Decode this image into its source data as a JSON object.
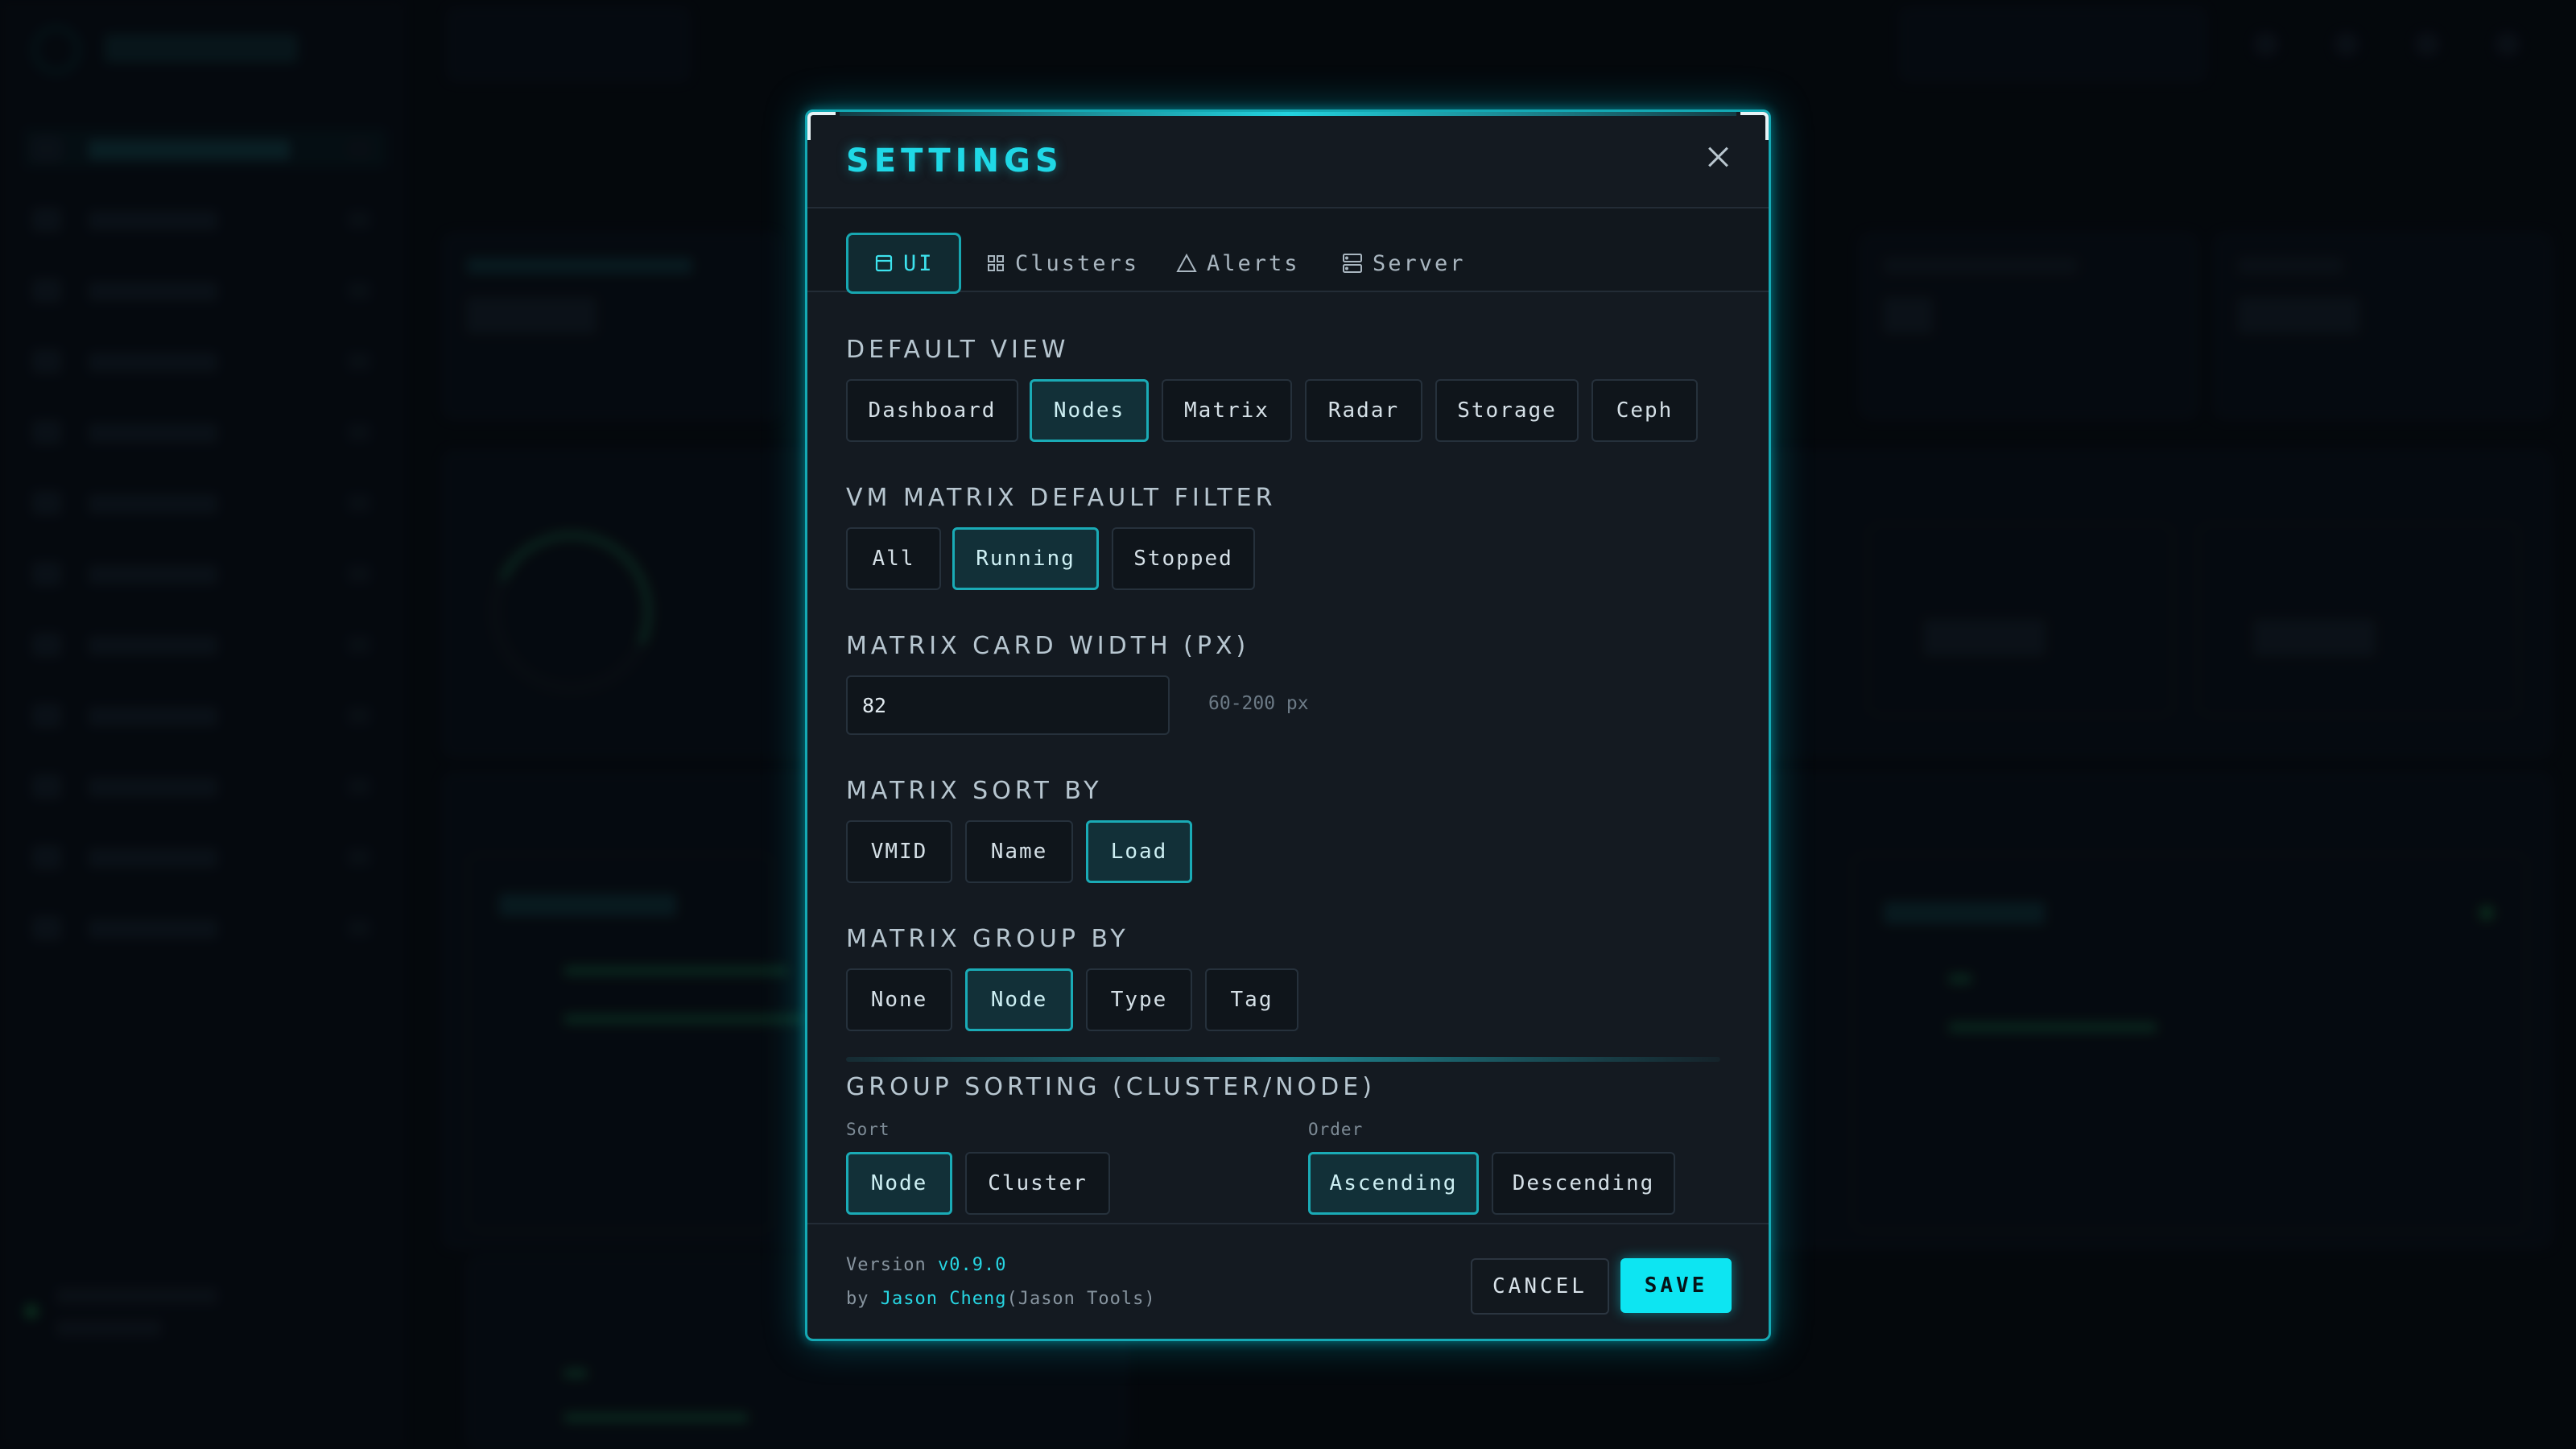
{
  "modal": {
    "title": "SETTINGS",
    "tabs": [
      {
        "label": "UI",
        "icon": "layout-icon",
        "active": true
      },
      {
        "label": "Clusters",
        "icon": "grid-icon",
        "active": false
      },
      {
        "label": "Alerts",
        "icon": "warning-triangle-icon",
        "active": false
      },
      {
        "label": "Server",
        "icon": "server-icon",
        "active": false
      }
    ],
    "default_view": {
      "label": "DEFAULT VIEW",
      "options": [
        "Dashboard",
        "Nodes",
        "Matrix",
        "Radar",
        "Storage",
        "Ceph"
      ],
      "selected": "Nodes"
    },
    "vm_matrix_filter": {
      "label": "VM MATRIX DEFAULT FILTER",
      "options": [
        "All",
        "Running",
        "Stopped"
      ],
      "selected": "Running"
    },
    "matrix_card_width": {
      "label": "MATRIX CARD WIDTH (PX)",
      "value": "82",
      "hint": "60-200 px"
    },
    "matrix_sort_by": {
      "label": "MATRIX SORT BY",
      "options": [
        "VMID",
        "Name",
        "Load"
      ],
      "selected": "Load"
    },
    "matrix_group_by": {
      "label": "MATRIX GROUP BY",
      "options": [
        "None",
        "Node",
        "Type",
        "Tag"
      ],
      "selected": "Node"
    },
    "group_sorting": {
      "label": "GROUP SORTING (CLUSTER/NODE)",
      "sort_label": "Sort",
      "sort_options": [
        "Node",
        "Cluster"
      ],
      "sort_selected": "Node",
      "order_label": "Order",
      "order_options": [
        "Ascending",
        "Descending"
      ],
      "order_selected": "Ascending"
    },
    "footer": {
      "version_prefix": "Version ",
      "version": "v0.9.0",
      "by_prefix": "by ",
      "author": "Jason Cheng",
      "org": "(Jason Tools)",
      "cancel_label": "CANCEL",
      "save_label": "SAVE"
    }
  },
  "colors": {
    "accent": "#1fd8e6",
    "save_button": "#0de5f2",
    "modal_bg": "#141a21",
    "page_bg": "#070b10"
  }
}
